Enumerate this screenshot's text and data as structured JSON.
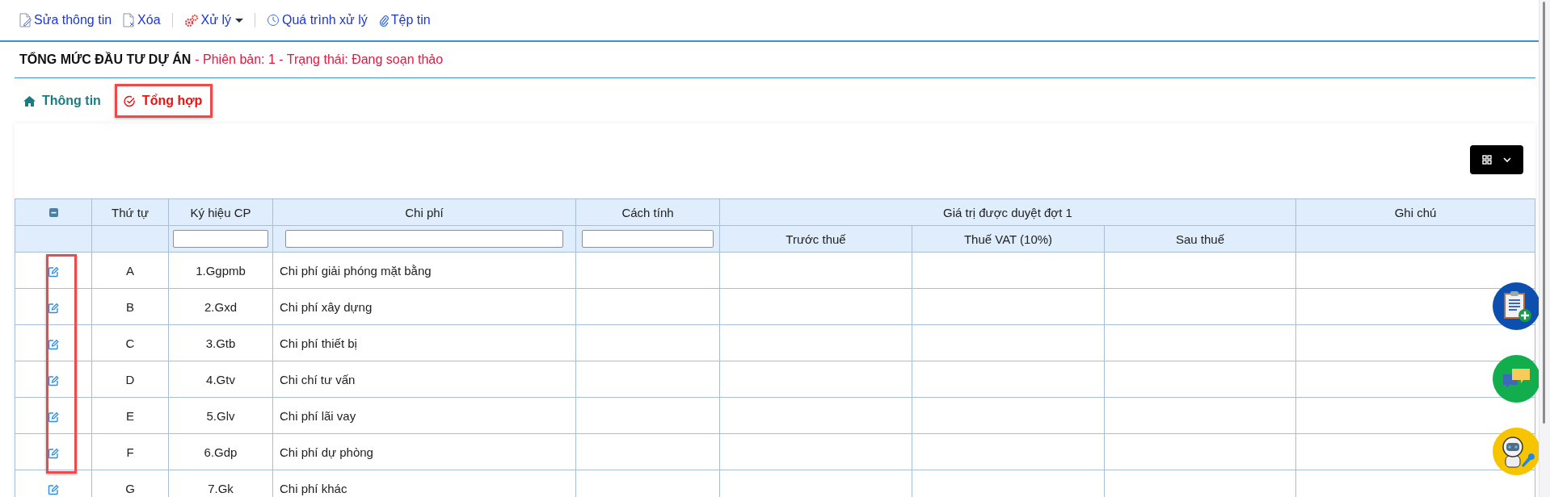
{
  "toolbar": [
    {
      "label": "Sửa thông tin",
      "kind": "edit",
      "separator_after": false
    },
    {
      "label": "Xóa",
      "kind": "delete",
      "separator_after": true
    },
    {
      "label": "Xử lý",
      "kind": "process",
      "separator_after": true
    },
    {
      "label": "Quá trình xử lý",
      "kind": "history",
      "separator_after": false
    },
    {
      "label": "Tệp tin",
      "kind": "attach",
      "separator_after": false
    }
  ],
  "header": {
    "title": "TỔNG MỨC ĐẦU TƯ DỰ ÁN",
    "status": "- Phiên bản: 1 - Trạng thái: Đang soạn thảo"
  },
  "tabs": [
    {
      "label": "Thông tin",
      "kind": "home",
      "selected": false,
      "highlighted": false
    },
    {
      "label": "Tổng hợp",
      "kind": "check",
      "selected": true,
      "highlighted": true
    }
  ],
  "table": {
    "columns": [
      "Thứ tự",
      "Ký hiệu CP",
      "Chi phí",
      "Cách tính"
    ],
    "group": {
      "label": "Giá trị được duyệt đợt 1",
      "columns": [
        "Trước thuế",
        "Thuế VAT (10%)",
        "Sau thuế"
      ]
    },
    "last_column": "Ghi chú",
    "rows": [
      {
        "order": "A",
        "code": "1.Ggpmb",
        "name": "Chi phí giải phóng mặt bằng",
        "highlighted": true
      },
      {
        "order": "B",
        "code": "2.Gxd",
        "name": "Chi phí xây dựng",
        "highlighted": true
      },
      {
        "order": "C",
        "code": "3.Gtb",
        "name": "Chi phí thiết bị",
        "highlighted": true
      },
      {
        "order": "D",
        "code": "4.Gtv",
        "name": "Chi chí tư vấn",
        "highlighted": true
      },
      {
        "order": "E",
        "code": "5.Glv",
        "name": "Chi phí lãi vay",
        "highlighted": true
      },
      {
        "order": "F",
        "code": "6.Gdp",
        "name": "Chi phí dự phòng",
        "highlighted": true
      },
      {
        "order": "G",
        "code": "7.Gk",
        "name": "Chi phí khác",
        "highlighted": false
      }
    ]
  },
  "float_buttons": [
    {
      "kind": "clipboard"
    },
    {
      "kind": "chat"
    },
    {
      "kind": "robot"
    }
  ]
}
